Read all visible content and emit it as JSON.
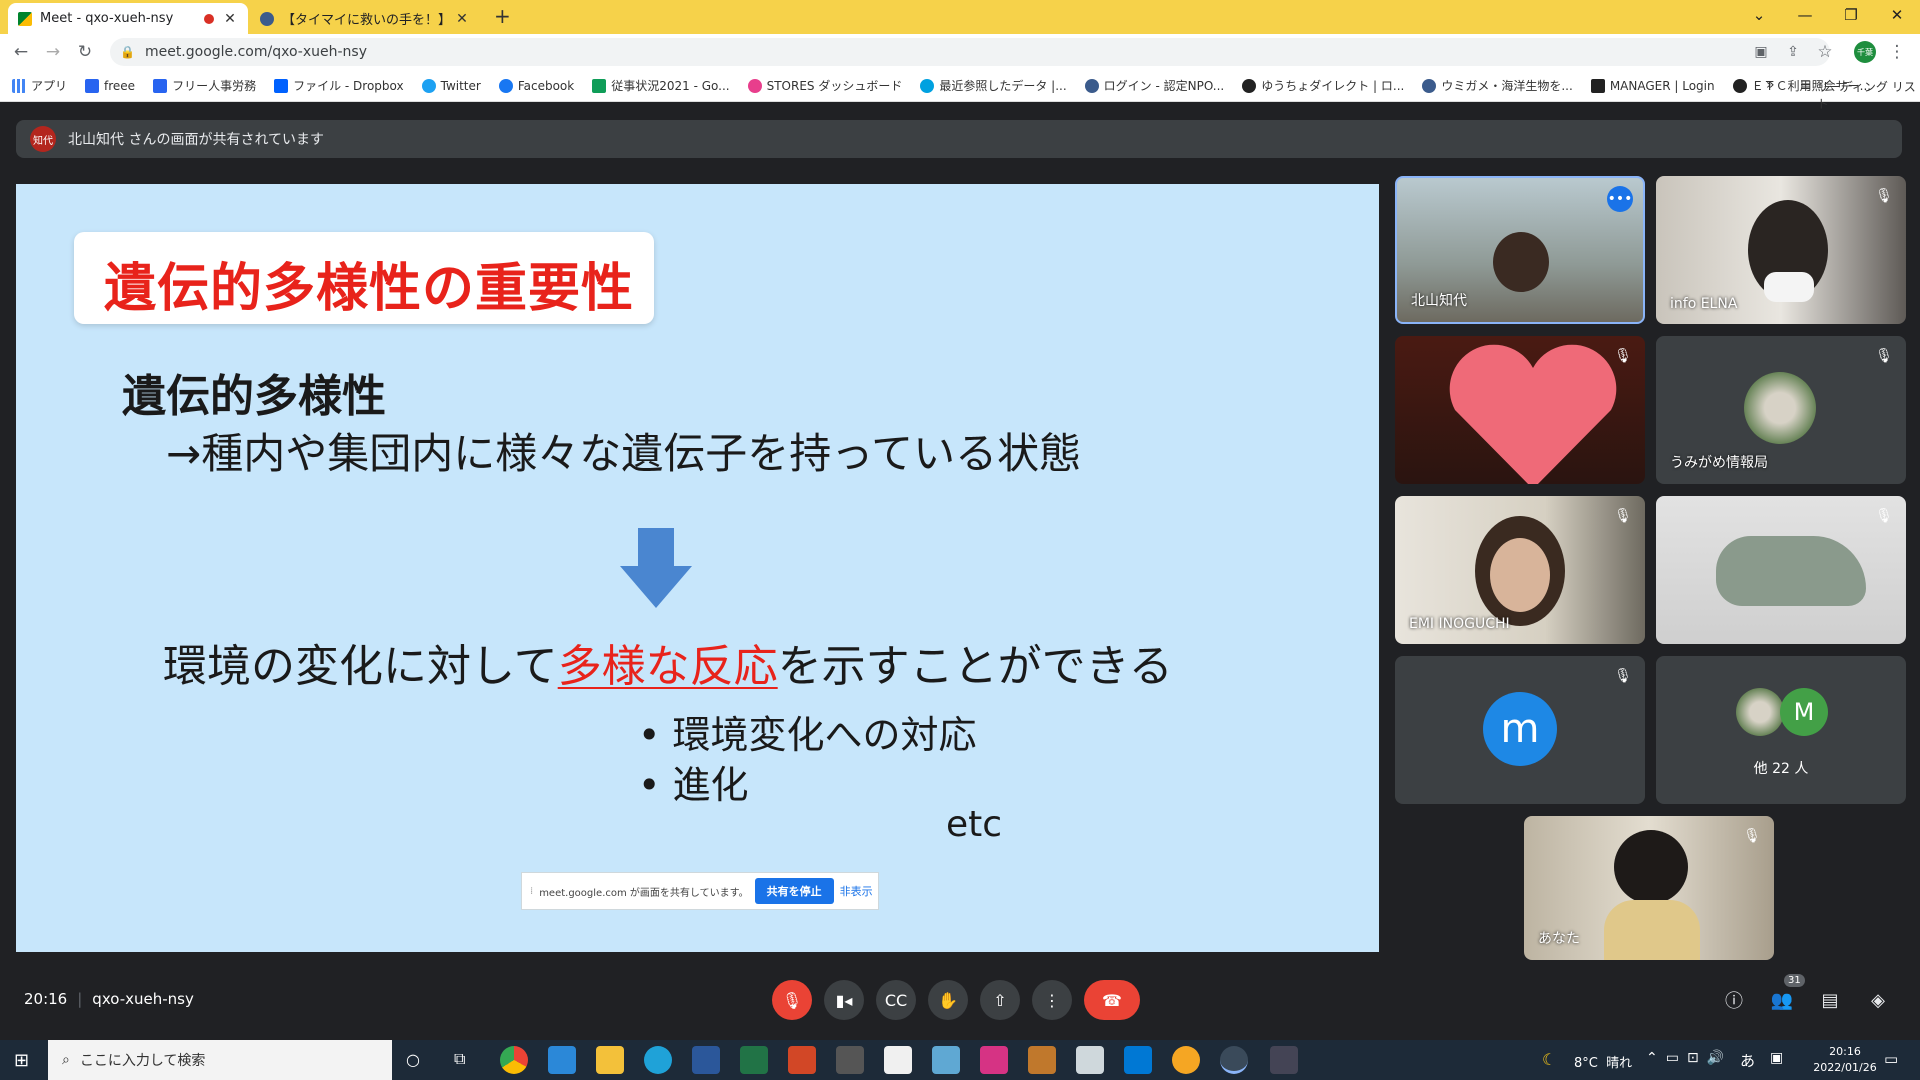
{
  "browser": {
    "tabs": [
      {
        "label": "Meet - qxo-xueh-nsy",
        "active": true
      },
      {
        "label": "【タイマイに救いの手を！】保全サポー",
        "active": false
      }
    ],
    "new_tab": "+",
    "url": "meet.google.com/qxo-xueh-nsy",
    "profile": "千葉",
    "reading_list": "リーディング リスト",
    "bookmarks": [
      "アプリ",
      "freee",
      "フリー人事労務",
      "ファイル - Dropbox",
      "Twitter",
      "Facebook",
      "従事状況2021 - Go...",
      "STORES ダッシュボード",
      "最近参照したデータ |...",
      "ログイン - 認定NPO...",
      "ゆうちょダイレクト | ロ...",
      "ウミガメ・海洋生物を...",
      "MANAGER | Login",
      "ＥＴＣ利用照会サー..."
    ],
    "more_bookmarks": "»"
  },
  "meet": {
    "presenter_initials": "知代",
    "presenting_notice": "北山知代 さんの画面が共有されています",
    "slide": {
      "title": "遺伝的多様性の重要性",
      "heading": "遺伝的多様性",
      "definition": "→種内や集団内に様々な遺伝子を持っている状態",
      "result_prefix": "環境の変化に対して",
      "result_highlight": "多様な反応",
      "result_suffix": "を示すことができる",
      "bullets": [
        "環境変化への対応",
        "進化"
      ],
      "etc": "etc"
    },
    "share_notice": {
      "text": "meet.google.com が画面を共有しています。",
      "stop": "共有を停止",
      "hide": "非表示"
    },
    "participants": [
      {
        "name": "北山知代"
      },
      {
        "name": "info ELNA"
      },
      {
        "name": ""
      },
      {
        "name": "うみがめ情報局"
      },
      {
        "name": "EMI INOGUCHI"
      },
      {
        "name": ""
      },
      {
        "name": "",
        "initial": "m"
      },
      {
        "name": "他 22 人",
        "initial": "M"
      }
    ],
    "self": {
      "name": "あなた"
    },
    "time": "20:16",
    "meeting_code": "qxo-xueh-nsy",
    "people_count": "31",
    "colors": {
      "end_call": "#ea4335",
      "accent": "#1a73e8",
      "slide_bg": "#c7e6fb",
      "slide_title": "#e8231b"
    }
  },
  "taskbar": {
    "search_placeholder": "ここに入力して検索",
    "weather": "8°C  晴れ",
    "ime": "あ",
    "clock_time": "20:16",
    "clock_date": "2022/01/26"
  }
}
